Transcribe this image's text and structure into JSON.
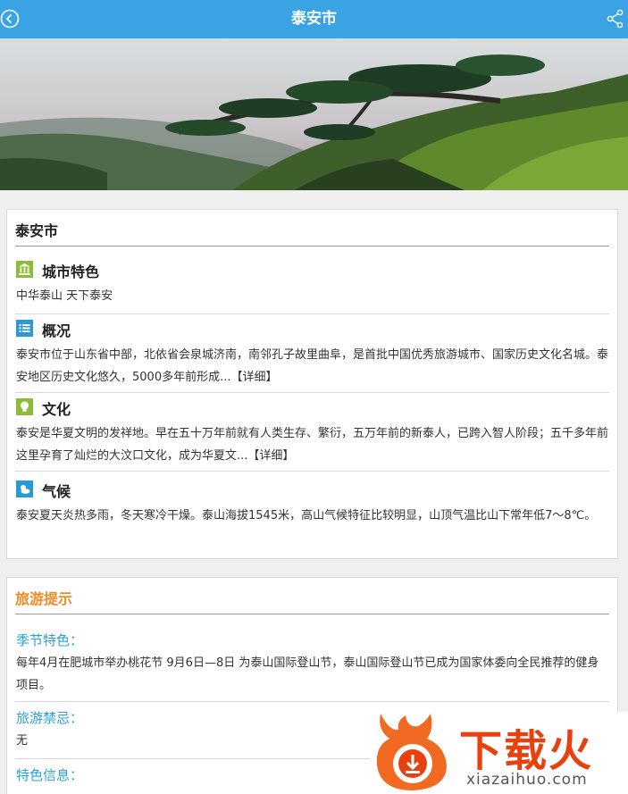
{
  "header": {
    "title": "泰安市",
    "back_icon": "back-icon",
    "share_icon": "share-icon",
    "color": "#3aa3e3"
  },
  "overview_card": {
    "title": "泰安市",
    "sections": [
      {
        "icon": "bank-icon",
        "label": "城市特色",
        "text": "中华泰山 天下泰安"
      },
      {
        "icon": "list-icon",
        "label": "概况",
        "text": "泰安市位于山东省中部，北依省会泉城济南，南邻孔子故里曲阜，是首批中国优秀旅游城市、国家历史文化名城。泰安地区历史文化悠久，5000多年前形成...【详细】"
      },
      {
        "icon": "lightbulb-icon",
        "label": "文化",
        "text": "泰安是华夏文明的发祥地。早在五十万年前就有人类生存、繁衍，五万年前的新泰人，已跨入智人阶段；五千多年前这里孕育了灿烂的大汶口文化，成为华夏文...【详细】"
      },
      {
        "icon": "weather-icon",
        "label": "气候",
        "text": "泰安夏天炎热多雨，冬天寒冷干燥。泰山海拔1545米，高山气候特征比较明显，山顶气温比山下常年低7～8℃。"
      }
    ]
  },
  "tips_card": {
    "title": "旅游提示",
    "items": [
      {
        "label": "季节特色：",
        "text": "每年4月在肥城市举办桃花节 9月6日—8日 为泰山国际登山节，泰山国际登山节已成为国家体委向全民推荐的健身项目。"
      },
      {
        "label": "旅游禁忌：",
        "text": "无"
      },
      {
        "label": "特色信息：",
        "text": ""
      }
    ]
  },
  "watermark": {
    "brand": "下载火",
    "url": "xiazaihuo.com",
    "color": "#e8410f"
  }
}
